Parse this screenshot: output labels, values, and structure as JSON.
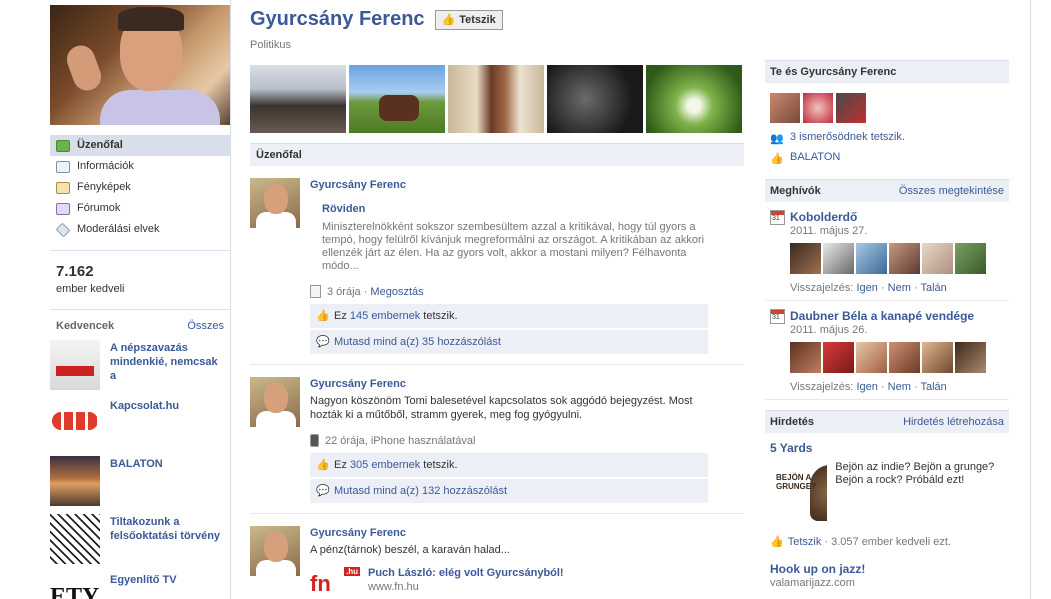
{
  "page": {
    "name": "Gyurcsány Ferenc",
    "like_button": "Tetszik",
    "category": "Politikus"
  },
  "nav": [
    {
      "label": "Üzenőfal",
      "icon": "wall-icon"
    },
    {
      "label": "Információk",
      "icon": "info-icon"
    },
    {
      "label": "Fényképek",
      "icon": "photos-icon"
    },
    {
      "label": "Fórumok",
      "icon": "forum-icon"
    },
    {
      "label": "Moderálási elvek",
      "icon": "moderation-icon"
    }
  ],
  "fans": {
    "count": "7.162",
    "label": "ember kedveli"
  },
  "favorites": {
    "title": "Kedvencek",
    "all": "Összes",
    "items": [
      {
        "name": "A népszavazás mindenkié, nemcsak a"
      },
      {
        "name": "Kapcsolat.hu"
      },
      {
        "name": "BALATON"
      },
      {
        "name": "Tiltakozunk a felsőoktatási törvény"
      },
      {
        "name": "Egyenlítő TV"
      }
    ]
  },
  "wall_heading": "Üzenőfal",
  "posts": [
    {
      "author": "Gyurcsány Ferenc",
      "attachment_title": "Röviden",
      "attachment_text": "Miniszterelnökként sokszor szembesültem azzal a kritikával, hogy túl gyors a tempó, hogy felülről kívánjuk megreformálni az országot. A kritikában az akkori ellenzék járt az élen. Ha az gyors volt, akkor a mostani milyen? Félhavonta módo...",
      "time": "3 órája",
      "share": "Megosztás",
      "likes_prefix": "Ez",
      "likes_count": "145 embernek",
      "likes_suffix": "tetszik.",
      "comments": "Mutasd mind a(z) 35 hozzászólást"
    },
    {
      "author": "Gyurcsány Ferenc",
      "text": "Nagyon köszönöm Tomi balesetével kapcsolatos sok aggódó bejegyzést. Most hozták ki a műtőből, stramm gyerek, meg fog gyógyulni.",
      "time": "22 órája, iPhone használatával",
      "likes_prefix": "Ez",
      "likes_count": "305 embernek",
      "likes_suffix": "tetszik.",
      "comments": "Mutasd mind a(z) 132 hozzászólást"
    },
    {
      "author": "Gyurcsány Ferenc",
      "text": "A pénz(tárnok) beszél, a karaván halad...",
      "link_title": "Puch László: elég volt Gyurcsányból!",
      "link_url": "www.fn.hu",
      "logo_text": "fn",
      "logo_badge": ".hu"
    }
  ],
  "friends_box": {
    "title": "Te és Gyurcsány Ferenc",
    "friends_like": "3 ismerősödnek tetszik.",
    "shared_like": "BALATON"
  },
  "invites": {
    "title": "Meghívók",
    "all": "Összes megtekintése",
    "events": [
      {
        "name": "Kobolderdő",
        "date": "2011. május 27.",
        "cal": "31",
        "rsvp_label": "Visszajelzés:",
        "yes": "Igen",
        "no": "Nem",
        "maybe": "Talán"
      },
      {
        "name": "Daubner Béla a kanapé vendége",
        "date": "2011. május 26.",
        "cal": "31",
        "rsvp_label": "Visszajelzés:",
        "yes": "Igen",
        "no": "Nem",
        "maybe": "Talán"
      }
    ]
  },
  "ads": {
    "title": "Hirdetés",
    "create": "Hirdetés létrehozása",
    "ad1_title": "5 Yards",
    "ad1_img_text": "BEJÖN A GRUNGE?",
    "ad1_text": "Bejön az indie? Bejön a grunge? Bejön a rock? Próbáld ezt!",
    "ad1_like": "Tetszik",
    "ad1_like_count": "· 3.057 ember kedveli ezt.",
    "ad2_title": "Hook up on jazz!",
    "ad2_url": "valamarijazz.com"
  }
}
